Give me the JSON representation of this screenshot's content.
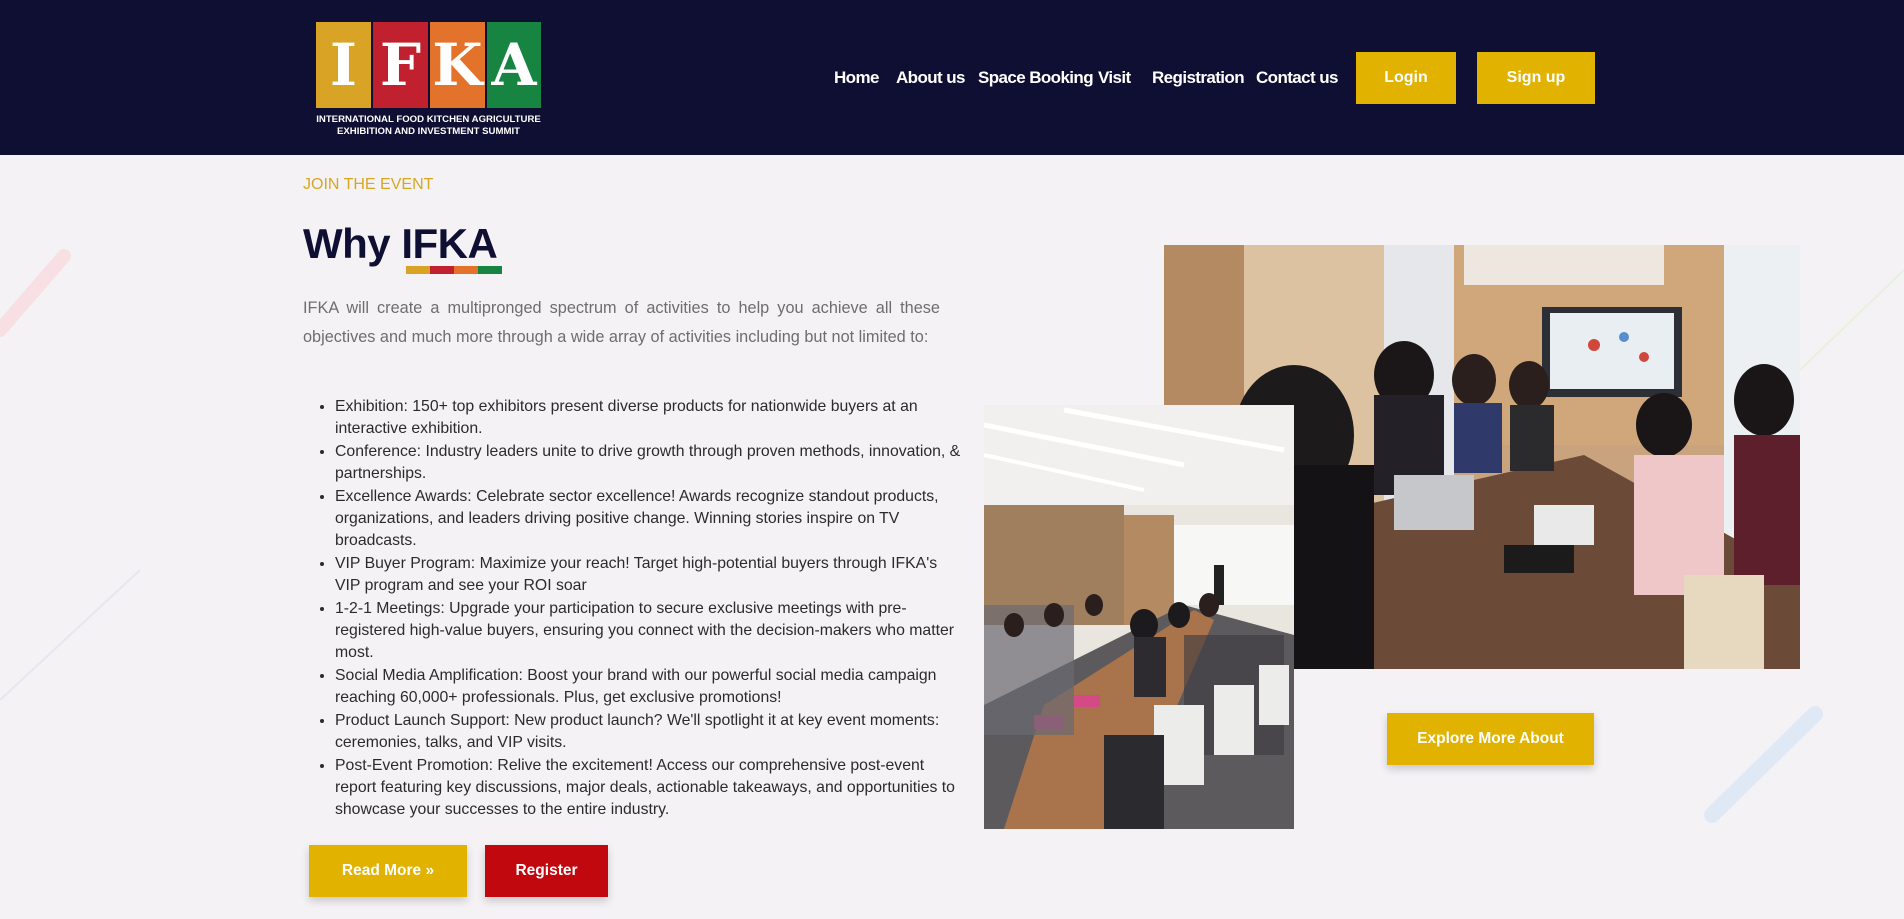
{
  "header": {
    "logo": {
      "letters": [
        "I",
        "F",
        "K",
        "A"
      ],
      "tile_colors": [
        "#d9a425",
        "#c1202e",
        "#e3722b",
        "#188442"
      ],
      "subtitle_line1": "INTERNATIONAL FOOD KITCHEN AGRICULTURE",
      "subtitle_line2": "EXHIBITION AND INVESTMENT SUMMIT"
    },
    "nav": [
      "Home",
      "About us",
      "Space Booking",
      "Visit",
      "Registration",
      "Contact us"
    ],
    "login_label": "Login",
    "signup_label": "Sign up"
  },
  "section": {
    "eyebrow": "JOIN THE EVENT",
    "title_prefix": "Why ",
    "title_highlight": "IFKA",
    "underline_colors": [
      "#d9a425",
      "#c1202e",
      "#e3722b",
      "#188442"
    ],
    "intro": "IFKA will create a multipronged spectrum of activities to help you achieve all these objectives and much more through a wide array of activities including but not limited to:",
    "items": [
      "Exhibition: 150+ top exhibitors present diverse products for nationwide buyers at an interactive exhibition.",
      "Conference: Industry leaders unite to drive growth through proven methods, innovation, & partnerships.",
      "Excellence Awards: Celebrate sector excellence! Awards recognize standout products, organizations, and leaders driving positive change. Winning stories inspire on TV broadcasts.",
      "VIP Buyer Program: Maximize your reach! Target high-potential buyers through IFKA's VIP program and see your ROI soar",
      "1-2-1 Meetings: Upgrade your participation to secure exclusive meetings with pre-registered high-value buyers, ensuring you connect with the decision-makers who matter most.",
      "Social Media Amplification: Boost your brand with our powerful social media campaign reaching 60,000+ professionals. Plus, get exclusive promotions!",
      "Product Launch Support: New product launch? We'll spotlight it at key event moments: ceremonies, talks, and VIP visits.",
      "Post-Event Promotion: Relive the excitement! Access our comprehensive post-event report featuring key discussions, major deals, actionable takeaways, and opportunities to showcase your successes to the entire industry."
    ],
    "read_more_label": "Read More »",
    "register_label": "Register",
    "explore_label": "Explore More About"
  },
  "colors": {
    "header_bg": "#0e0f32",
    "accent_yellow": "#e1b200",
    "accent_red": "#c1080e",
    "page_bg": "#f4f2f5"
  }
}
